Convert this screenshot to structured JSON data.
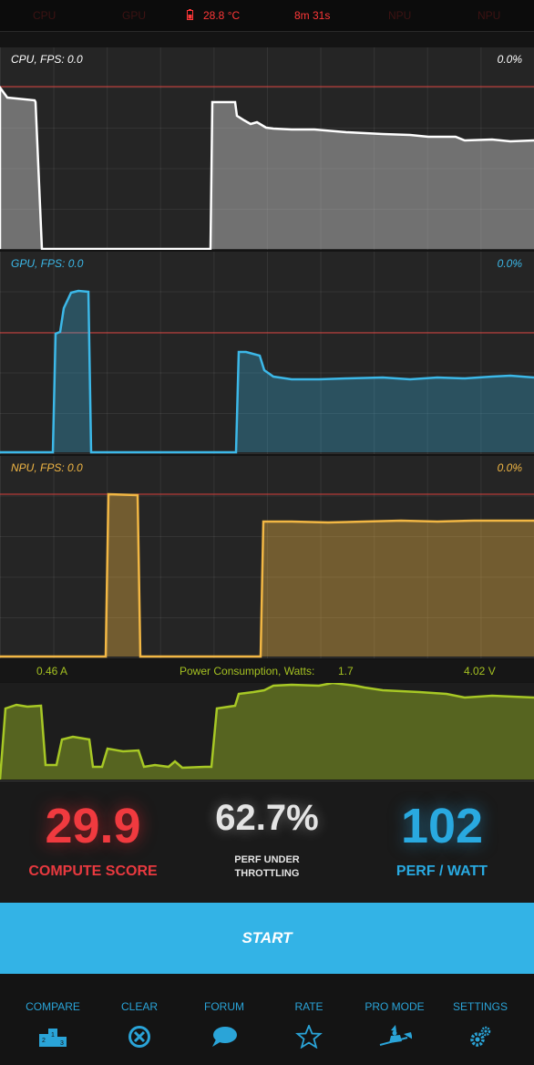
{
  "status_bar": {
    "cpu": "CPU",
    "gpu": "GPU",
    "temperature": "28.8 °C",
    "elapsed": "8m 31s",
    "npu_1": "NPU",
    "npu_2": "NPU"
  },
  "panels": {
    "cpu": {
      "label": "CPU, FPS:",
      "fps": "0.0",
      "percent": "0.0%",
      "color": "#ffffff"
    },
    "gpu": {
      "label": "GPU, FPS:",
      "fps": "0.0",
      "percent": "0.0%",
      "color": "#3cb8e8"
    },
    "npu": {
      "label": "NPU, FPS:",
      "fps": "0.0",
      "percent": "0.0%",
      "color": "#f2b744"
    }
  },
  "power": {
    "current": "0.46 A",
    "label": "Power Consumption, Watts:",
    "watts": "1.7",
    "voltage": "4.02 V",
    "color": "#a7c825"
  },
  "scores": {
    "compute_value": "29.9",
    "compute_label": "COMPUTE SCORE",
    "throttling_value": "62.7%",
    "throttling_label_1": "PERF UNDER",
    "throttling_label_2": "THROTTLING",
    "ppw_value": "102",
    "ppw_label": "PERF / WATT"
  },
  "start_label": "START",
  "nav": [
    {
      "label": "COMPARE",
      "icon": "podium-icon"
    },
    {
      "label": "CLEAR",
      "icon": "clear-circle-icon"
    },
    {
      "label": "FORUM",
      "icon": "speech-bubble-icon"
    },
    {
      "label": "RATE",
      "icon": "star-icon"
    },
    {
      "label": "PRO MODE",
      "icon": "witch-icon"
    },
    {
      "label": "SETTINGS",
      "icon": "gears-icon"
    }
  ],
  "colors": {
    "accent": "#33b3e6",
    "score_red": "#f03a3f",
    "score_blue": "#29a9e0",
    "threshold_line": "#d8403c"
  }
}
